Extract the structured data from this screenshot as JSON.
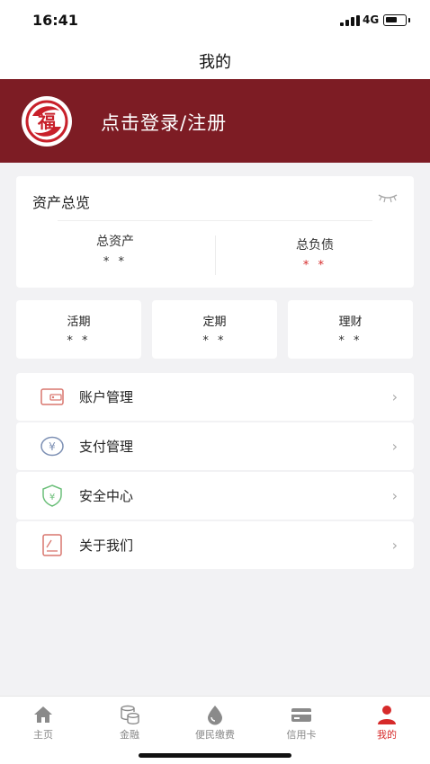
{
  "status_bar": {
    "time": "16:41",
    "network": "4G"
  },
  "nav": {
    "title": "我的"
  },
  "banner": {
    "login_text": "点击登录/注册",
    "avatar_glyph": "福"
  },
  "overview": {
    "title": "资产总览",
    "total_assets_label": "总资产",
    "total_assets_value": "* *",
    "total_liabilities_label": "总负债",
    "total_liabilities_value": "* *"
  },
  "accounts": [
    {
      "label": "活期",
      "value": "* *"
    },
    {
      "label": "定期",
      "value": "* *"
    },
    {
      "label": "理财",
      "value": "* *"
    }
  ],
  "menu": [
    {
      "label": "账户管理",
      "icon": "wallet-icon"
    },
    {
      "label": "支付管理",
      "icon": "yuan-coin-icon"
    },
    {
      "label": "安全中心",
      "icon": "shield-icon"
    },
    {
      "label": "关于我们",
      "icon": "info-card-icon"
    }
  ],
  "tabs": [
    {
      "label": "主页",
      "icon": "home-icon"
    },
    {
      "label": "金融",
      "icon": "coins-icon"
    },
    {
      "label": "便民缴费",
      "icon": "water-drop-icon"
    },
    {
      "label": "信用卡",
      "icon": "credit-card-icon"
    },
    {
      "label": "我的",
      "icon": "person-icon",
      "active": true
    }
  ],
  "colors": {
    "brand": "#7d1c24",
    "accent": "#d62a2a"
  }
}
